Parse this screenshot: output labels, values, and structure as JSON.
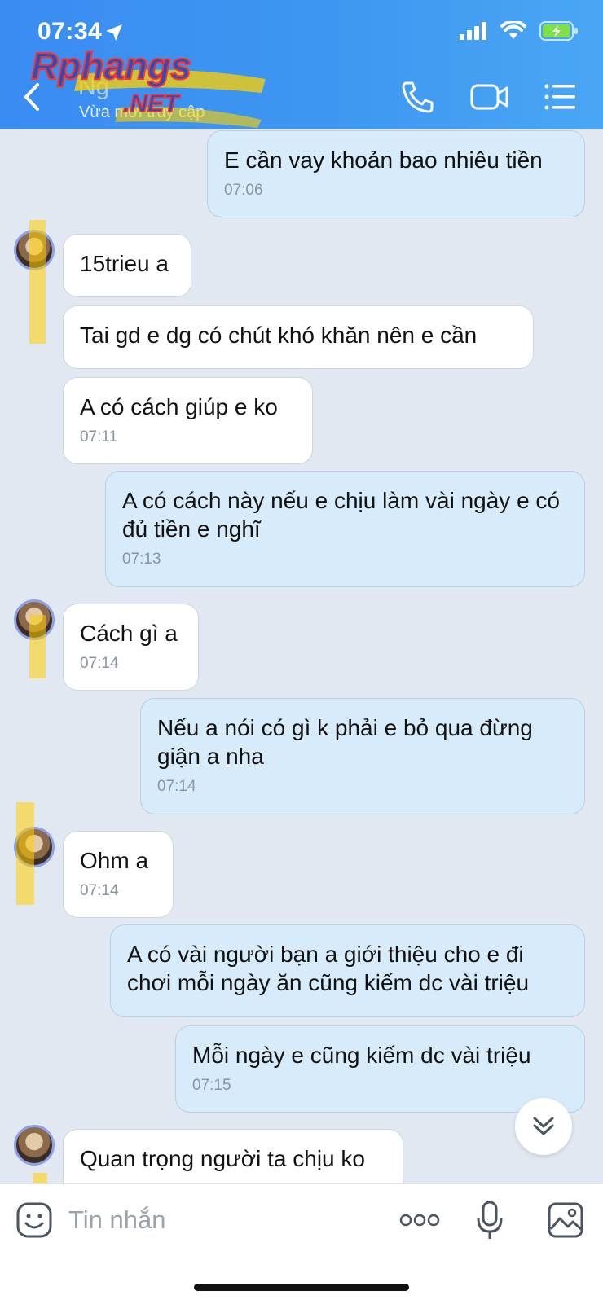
{
  "status_bar": {
    "time": "07:34"
  },
  "header": {
    "contact_name": "Ng",
    "contact_status": "Vừa mới truy cập",
    "watermark_top": "Rphangs",
    "watermark_bottom": ".NET"
  },
  "messages": [
    {
      "direction": "out",
      "text": "E cần vay khoản bao nhiêu tiền",
      "time": "07:06"
    },
    {
      "direction": "in",
      "text": "15trieu a",
      "time": ""
    },
    {
      "direction": "in",
      "text": "Tai gd e dg có chút khó khăn nên e cần",
      "time": ""
    },
    {
      "direction": "in",
      "text": "A có cách giúp e ko",
      "time": "07:11"
    },
    {
      "direction": "out",
      "text": "A có cách này nếu e chịu làm vài ngày e có đủ tiền e nghĩ",
      "time": "07:13"
    },
    {
      "direction": "in",
      "text": "Cách gì a",
      "time": "07:14"
    },
    {
      "direction": "out",
      "text": "Nếu a nói có gì k phải e bỏ qua đừng giận a nha",
      "time": "07:14"
    },
    {
      "direction": "in",
      "text": "Ohm a",
      "time": "07:14"
    },
    {
      "direction": "out",
      "text": "A có vài người bạn a giới thiệu cho e đi chơi mỗi ngày ăn cũng kiếm dc vài triệu",
      "time": ""
    },
    {
      "direction": "out",
      "text": "Mỗi ngày e cũng kiếm dc vài triệu",
      "time": "07:15"
    },
    {
      "direction": "in",
      "text": "Quan trọng người ta chịu ko",
      "time": ""
    }
  ],
  "composer": {
    "placeholder": "Tin nhắn"
  },
  "icons": {
    "back": "chevron-left-icon",
    "call": "phone-icon",
    "video": "video-camera-icon",
    "menu": "list-menu-icon",
    "emoji": "emoji-icon",
    "more": "more-dots-icon",
    "mic": "microphone-icon",
    "gallery": "image-gallery-icon",
    "scroll": "double-chevron-down-icon"
  },
  "colors": {
    "header_bg": "#3d92f1",
    "incoming_bubble": "#ffffff",
    "outgoing_bubble": "#d7ebfb",
    "chat_bg": "#e2e8f2"
  }
}
